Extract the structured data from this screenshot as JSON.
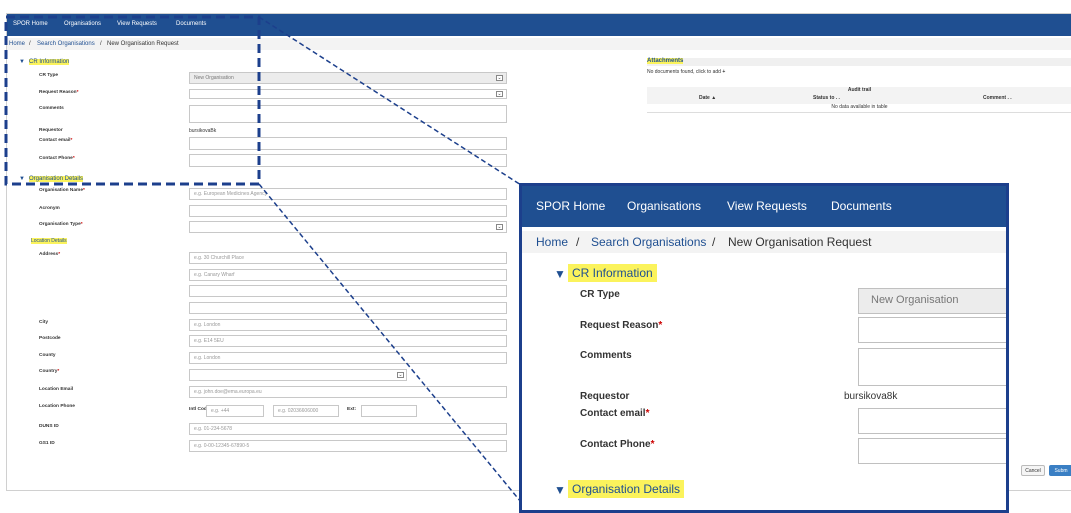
{
  "nav": {
    "items": [
      "SPOR Home",
      "Organisations",
      "View Requests",
      "Documents"
    ]
  },
  "breadcrumb": {
    "home": "Home",
    "search": "Search Organisations",
    "current": "New Organisation Request",
    "sep": "/"
  },
  "cr": {
    "title": "CR Information",
    "cr_type_label": "CR Type",
    "cr_type_value": "New Organisation",
    "request_reason_label": "Request Reason",
    "comments_label": "Comments",
    "requestor_label": "Requestor",
    "requestor_value": "bursikova8k",
    "requestor_value_small": "bursikovaBk",
    "contact_email_label": "Contact email",
    "contact_phone_label": "Contact Phone",
    "required_mark": "*"
  },
  "org": {
    "title": "Organisation Details",
    "name_label": "Organisation Name",
    "name_placeholder": "e.g. European Medicines Agency",
    "acronym_label": "Acronym",
    "type_label": "Organisation Type",
    "location_title": "Location Details",
    "address_label": "Address",
    "address1_placeholder": "e.g. 30 Churchill Place",
    "address2_placeholder": "e.g. Canary Wharf",
    "city_label": "City",
    "city_placeholder": "e.g. London",
    "postcode_label": "Postcode",
    "postcode_placeholder": "e.g. E14 5EU",
    "county_label": "County",
    "county_placeholder": "e.g. London",
    "country_label": "Country",
    "location_email_label": "Location Email",
    "location_email_placeholder": "e.g. john.doe@ema.europa.eu",
    "location_phone_label": "Location Phone",
    "intl_code_label": "Intl Code:",
    "intl_code_placeholder": "e.g. +44",
    "phone_placeholder": "e.g. 02036606000",
    "ext_label": "Ext:",
    "duns_label": "DUNS ID",
    "duns_placeholder": "e.g. 01-234-5678",
    "gs1_label": "GS1 ID",
    "gs1_placeholder": "e.g. 0-00-12345-67890-5"
  },
  "attachments": {
    "title": "Attachments",
    "empty_text": "No documents found, click to add",
    "add_icon": "+"
  },
  "audit": {
    "title": "Audit trail",
    "columns": [
      "Date ▲",
      "Status to . .",
      "Comment . ."
    ],
    "empty": "No data available in table"
  },
  "buttons": {
    "cancel": "Cancel",
    "submit": "Subm"
  },
  "icons": {
    "caret": "▼",
    "chevron": "⌄"
  },
  "colors": {
    "nav": "#1f4f91",
    "highlight": "#fbf35c",
    "dash": "#1c3f8c",
    "required": "#cc0000"
  }
}
